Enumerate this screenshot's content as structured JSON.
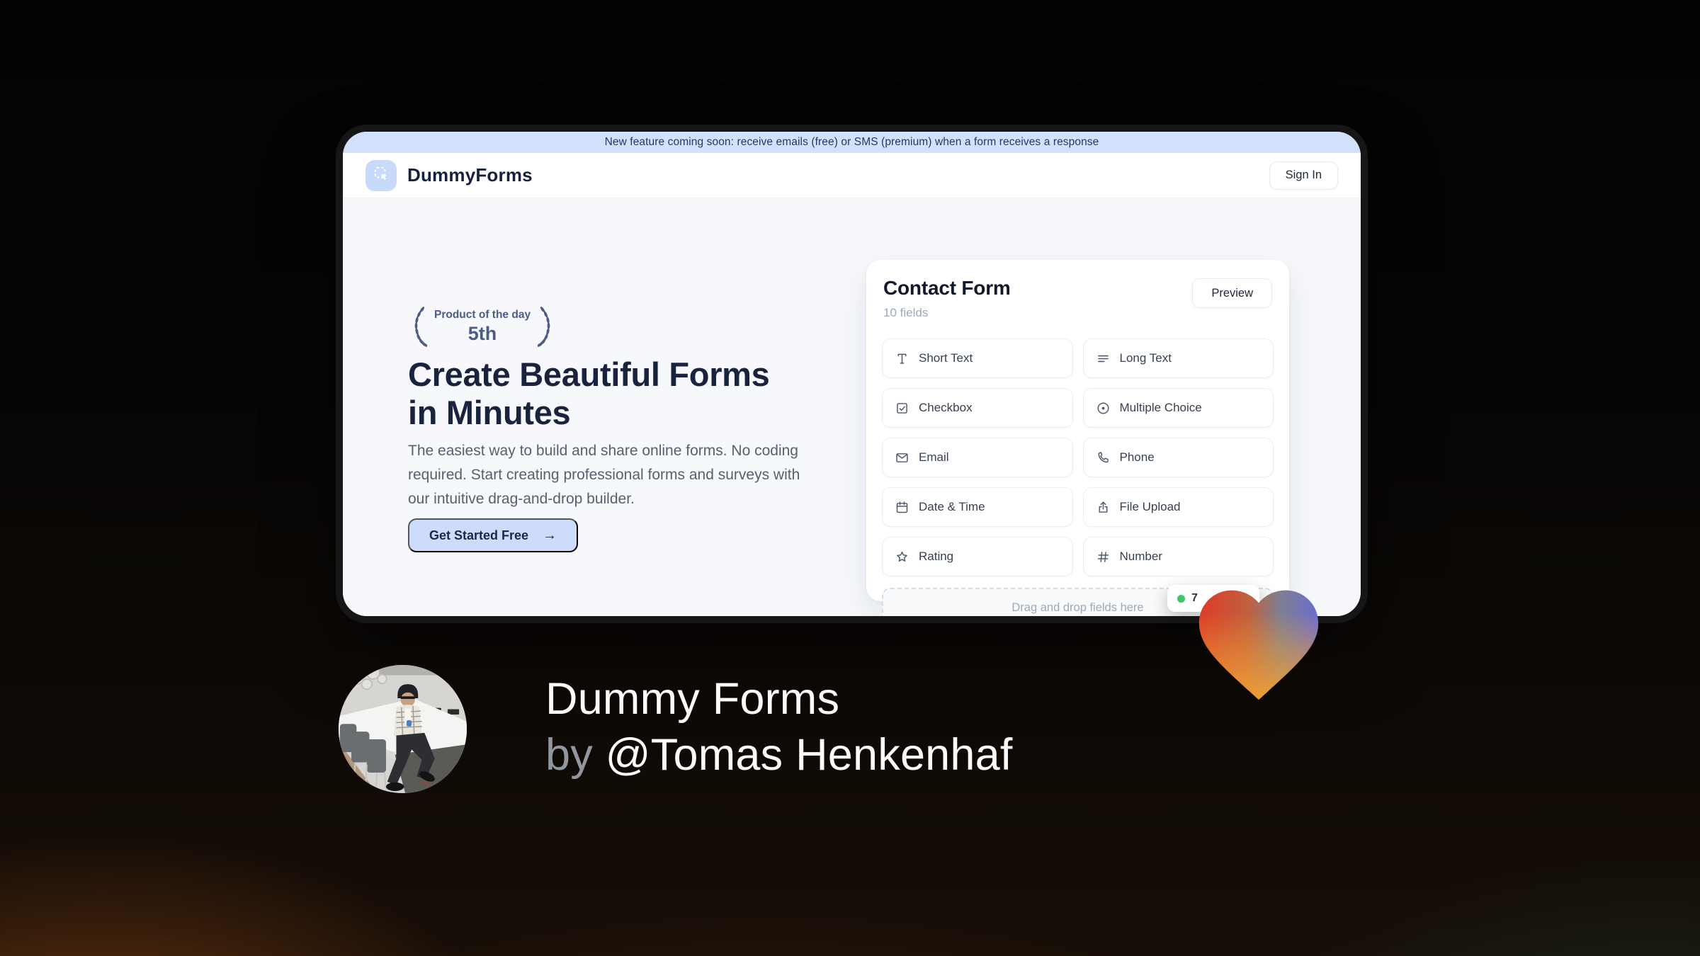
{
  "browser_card": {
    "banner": {
      "text": "New feature coming soon: receive emails (free) or SMS (premium) when a form receives a response",
      "bg_color": "#d2e1fc",
      "text_color": "#203a66"
    },
    "header": {
      "brand": "DummyForms",
      "sign_in_label": "Sign In"
    },
    "hero": {
      "badge": {
        "line1": "Product of the day",
        "line2": "5th"
      },
      "heading": "Create Beautiful Forms in Minutes",
      "description": "The easiest way to build and share online forms. No coding required. Start creating professional forms and surveys with our intuitive drag-and-drop builder.",
      "cta_label": "Get Started Free",
      "cta_arrow": "→"
    },
    "form_card": {
      "title": "Contact Form",
      "subtitle": "10 fields",
      "preview_label": "Preview",
      "fields": [
        {
          "label": "Short Text",
          "icon": "short-text"
        },
        {
          "label": "Long Text",
          "icon": "long-text"
        },
        {
          "label": "Checkbox",
          "icon": "checkbox"
        },
        {
          "label": "Multiple Choice",
          "icon": "radio"
        },
        {
          "label": "Email",
          "icon": "email"
        },
        {
          "label": "Phone",
          "icon": "phone"
        },
        {
          "label": "Date & Time",
          "icon": "calendar"
        },
        {
          "label": "File Upload",
          "icon": "upload"
        },
        {
          "label": "Rating",
          "icon": "star"
        },
        {
          "label": "Number",
          "icon": "hash"
        }
      ],
      "dropzone_text": "Drag and drop fields here",
      "responses_badge": {
        "text": "7",
        "dot_color": "#3ec764"
      }
    }
  },
  "footer": {
    "title": "Dummy Forms",
    "byline_prefix": "by ",
    "byline_name": "@Tomas Henkenhaf"
  },
  "colors": {
    "accent_blue": "#ccdcfa",
    "brand_navy": "#15223b",
    "badge_green": "#3ec764",
    "heart_red": "#df3b27",
    "heart_orange": "#f0a035",
    "heart_purple": "#6c6cd2",
    "bg_glow_warm": "#7e4011",
    "bg_glow_green": "#1c402c"
  }
}
